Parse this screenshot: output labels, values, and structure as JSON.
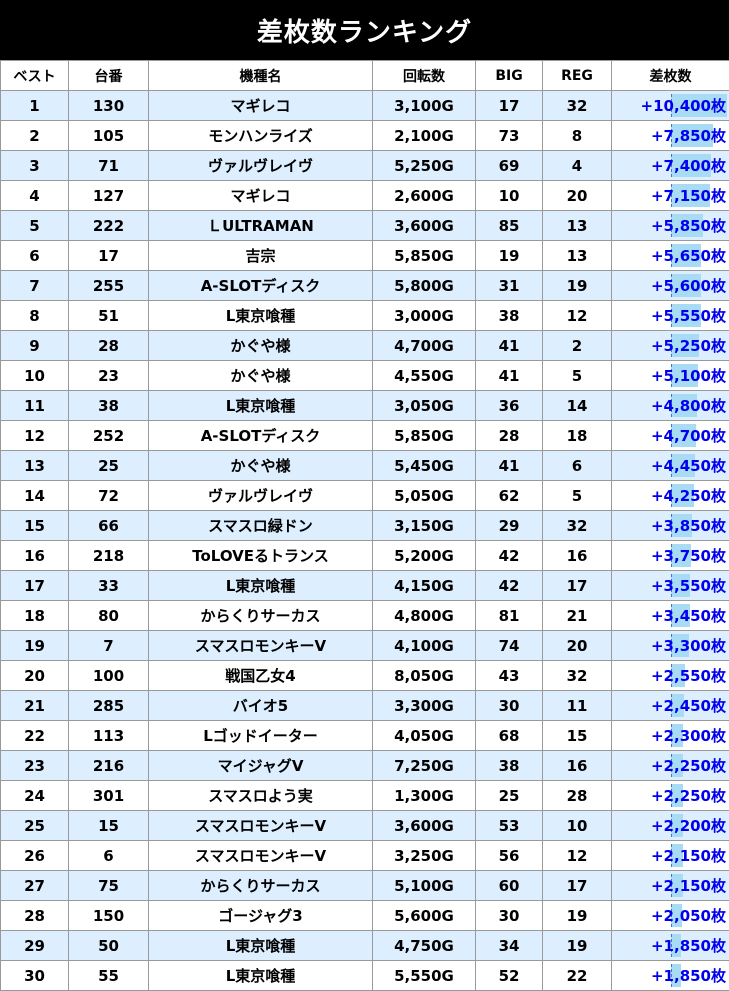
{
  "title": "差枚数ランキング",
  "columns": [
    "ベスト",
    "台番",
    "機種名",
    "回転数",
    "BIG",
    "REG",
    "差枚数"
  ],
  "max_diff": 10400,
  "rows": [
    {
      "rank": "1",
      "machine_no": "130",
      "name": "マギレコ",
      "spins": "3,100G",
      "big": "17",
      "reg": "32",
      "diff": "+10,400枚",
      "diff_value": 10400
    },
    {
      "rank": "2",
      "machine_no": "105",
      "name": "モンハンライズ",
      "spins": "2,100G",
      "big": "73",
      "reg": "8",
      "diff": "+7,850枚",
      "diff_value": 7850
    },
    {
      "rank": "3",
      "machine_no": "71",
      "name": "ヴァルヴレイヴ",
      "spins": "5,250G",
      "big": "69",
      "reg": "4",
      "diff": "+7,400枚",
      "diff_value": 7400
    },
    {
      "rank": "4",
      "machine_no": "127",
      "name": "マギレコ",
      "spins": "2,600G",
      "big": "10",
      "reg": "20",
      "diff": "+7,150枚",
      "diff_value": 7150
    },
    {
      "rank": "5",
      "machine_no": "222",
      "name": "ＬULTRAMAN",
      "spins": "3,600G",
      "big": "85",
      "reg": "13",
      "diff": "+5,850枚",
      "diff_value": 5850
    },
    {
      "rank": "6",
      "machine_no": "17",
      "name": "吉宗",
      "spins": "5,850G",
      "big": "19",
      "reg": "13",
      "diff": "+5,650枚",
      "diff_value": 5650
    },
    {
      "rank": "7",
      "machine_no": "255",
      "name": "A-SLOTディスク",
      "spins": "5,800G",
      "big": "31",
      "reg": "19",
      "diff": "+5,600枚",
      "diff_value": 5600
    },
    {
      "rank": "8",
      "machine_no": "51",
      "name": "L東京喰種",
      "spins": "3,000G",
      "big": "38",
      "reg": "12",
      "diff": "+5,550枚",
      "diff_value": 5550
    },
    {
      "rank": "9",
      "machine_no": "28",
      "name": "かぐや様",
      "spins": "4,700G",
      "big": "41",
      "reg": "2",
      "diff": "+5,250枚",
      "diff_value": 5250
    },
    {
      "rank": "10",
      "machine_no": "23",
      "name": "かぐや様",
      "spins": "4,550G",
      "big": "41",
      "reg": "5",
      "diff": "+5,100枚",
      "diff_value": 5100
    },
    {
      "rank": "11",
      "machine_no": "38",
      "name": "L東京喰種",
      "spins": "3,050G",
      "big": "36",
      "reg": "14",
      "diff": "+4,800枚",
      "diff_value": 4800
    },
    {
      "rank": "12",
      "machine_no": "252",
      "name": "A-SLOTディスク",
      "spins": "5,850G",
      "big": "28",
      "reg": "18",
      "diff": "+4,700枚",
      "diff_value": 4700
    },
    {
      "rank": "13",
      "machine_no": "25",
      "name": "かぐや様",
      "spins": "5,450G",
      "big": "41",
      "reg": "6",
      "diff": "+4,450枚",
      "diff_value": 4450
    },
    {
      "rank": "14",
      "machine_no": "72",
      "name": "ヴァルヴレイヴ",
      "spins": "5,050G",
      "big": "62",
      "reg": "5",
      "diff": "+4,250枚",
      "diff_value": 4250
    },
    {
      "rank": "15",
      "machine_no": "66",
      "name": "スマスロ緑ドン",
      "spins": "3,150G",
      "big": "29",
      "reg": "32",
      "diff": "+3,850枚",
      "diff_value": 3850
    },
    {
      "rank": "16",
      "machine_no": "218",
      "name": "ToLOVEるトランス",
      "spins": "5,200G",
      "big": "42",
      "reg": "16",
      "diff": "+3,750枚",
      "diff_value": 3750
    },
    {
      "rank": "17",
      "machine_no": "33",
      "name": "L東京喰種",
      "spins": "4,150G",
      "big": "42",
      "reg": "17",
      "diff": "+3,550枚",
      "diff_value": 3550
    },
    {
      "rank": "18",
      "machine_no": "80",
      "name": "からくりサーカス",
      "spins": "4,800G",
      "big": "81",
      "reg": "21",
      "diff": "+3,450枚",
      "diff_value": 3450
    },
    {
      "rank": "19",
      "machine_no": "7",
      "name": "スマスロモンキーV",
      "spins": "4,100G",
      "big": "74",
      "reg": "20",
      "diff": "+3,300枚",
      "diff_value": 3300
    },
    {
      "rank": "20",
      "machine_no": "100",
      "name": "戦国乙女4",
      "spins": "8,050G",
      "big": "43",
      "reg": "32",
      "diff": "+2,550枚",
      "diff_value": 2550
    },
    {
      "rank": "21",
      "machine_no": "285",
      "name": "バイオ5",
      "spins": "3,300G",
      "big": "30",
      "reg": "11",
      "diff": "+2,450枚",
      "diff_value": 2450
    },
    {
      "rank": "22",
      "machine_no": "113",
      "name": "Lゴッドイーター",
      "spins": "4,050G",
      "big": "68",
      "reg": "15",
      "diff": "+2,300枚",
      "diff_value": 2300
    },
    {
      "rank": "23",
      "machine_no": "216",
      "name": "マイジャグV",
      "spins": "7,250G",
      "big": "38",
      "reg": "16",
      "diff": "+2,250枚",
      "diff_value": 2250
    },
    {
      "rank": "24",
      "machine_no": "301",
      "name": "スマスロよう実",
      "spins": "1,300G",
      "big": "25",
      "reg": "28",
      "diff": "+2,250枚",
      "diff_value": 2250
    },
    {
      "rank": "25",
      "machine_no": "15",
      "name": "スマスロモンキーV",
      "spins": "3,600G",
      "big": "53",
      "reg": "10",
      "diff": "+2,200枚",
      "diff_value": 2200
    },
    {
      "rank": "26",
      "machine_no": "6",
      "name": "スマスロモンキーV",
      "spins": "3,250G",
      "big": "56",
      "reg": "12",
      "diff": "+2,150枚",
      "diff_value": 2150
    },
    {
      "rank": "27",
      "machine_no": "75",
      "name": "からくりサーカス",
      "spins": "5,100G",
      "big": "60",
      "reg": "17",
      "diff": "+2,150枚",
      "diff_value": 2150
    },
    {
      "rank": "28",
      "machine_no": "150",
      "name": "ゴージャグ3",
      "spins": "5,600G",
      "big": "30",
      "reg": "19",
      "diff": "+2,050枚",
      "diff_value": 2050
    },
    {
      "rank": "29",
      "machine_no": "50",
      "name": "L東京喰種",
      "spins": "4,750G",
      "big": "34",
      "reg": "19",
      "diff": "+1,850枚",
      "diff_value": 1850
    },
    {
      "rank": "30",
      "machine_no": "55",
      "name": "L東京喰種",
      "spins": "5,550G",
      "big": "52",
      "reg": "22",
      "diff": "+1,850枚",
      "diff_value": 1850
    }
  ],
  "colors": {
    "title_bg": "#000000",
    "title_text": "#ffffff",
    "row_alt": "#ddeeff",
    "diff_text": "#0000ee",
    "diff_bar": "#a8dcf5"
  }
}
